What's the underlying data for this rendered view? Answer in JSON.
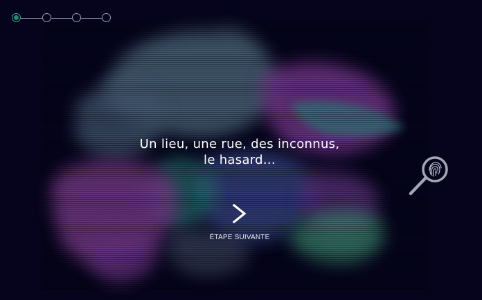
{
  "stepper": {
    "total_steps": 4,
    "current_step": 1
  },
  "headline": {
    "line1": "Un lieu, une rue, des inconnus,",
    "line2": "le hasard..."
  },
  "next": {
    "label": "ÉTAPE SUIVANTE",
    "icon": "chevron-right-icon"
  },
  "clue": {
    "icon": "magnifier-fingerprint-icon"
  },
  "colors": {
    "background": "#05041c",
    "accent": "#1f8a6e",
    "purple": "#8a3d9a",
    "teal": "#2f8a80",
    "slate": "#5a6f86"
  }
}
